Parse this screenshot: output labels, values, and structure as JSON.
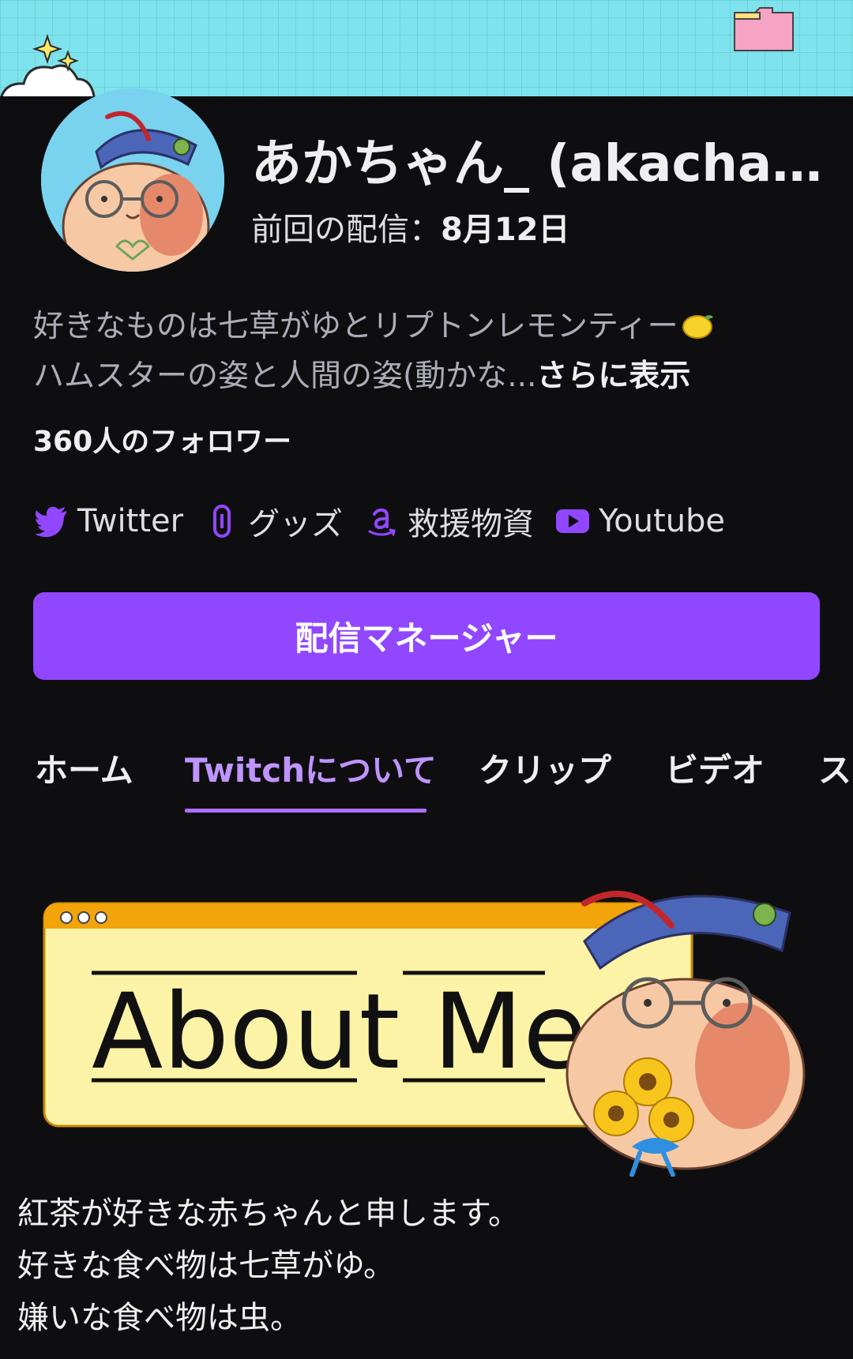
{
  "channel": {
    "name": "あかちゃん_ (akachana...",
    "last_stream_label": "前回の配信：",
    "last_stream_date": "8月12日",
    "bio_line1": "好きなものは七草がゆとリプトンレモンティー",
    "bio_line2": "ハムスターの姿と人間の姿(動かな...",
    "bio_more": "さらに表示",
    "followers": "360人のフォロワー"
  },
  "socials": [
    {
      "label": "Twitter",
      "icon": "twitter-bird-icon"
    },
    {
      "label": "グッズ",
      "icon": "link-icon"
    },
    {
      "label": "救援物資",
      "icon": "amazon-icon"
    },
    {
      "label": "Youtube",
      "icon": "youtube-icon"
    }
  ],
  "primary_button": {
    "label": "配信マネージャー"
  },
  "tabs": [
    {
      "label": "ホーム",
      "active": false
    },
    {
      "label": "Twitchについて",
      "active": true
    },
    {
      "label": "クリップ",
      "active": false
    },
    {
      "label": "ビデオ",
      "active": false
    },
    {
      "label": "ス",
      "active": false
    }
  ],
  "panel": {
    "title": "About Me"
  },
  "about": {
    "lines": [
      "紅茶が好きな赤ちゃんと申します。",
      "好きな食べ物は七草がゆ。",
      "嫌いな食べ物は虫。"
    ]
  },
  "colors": {
    "accent": "#9147ff",
    "active_tab": "#bf94ff",
    "background": "#0e0e10",
    "banner": "#7ee3ec"
  }
}
